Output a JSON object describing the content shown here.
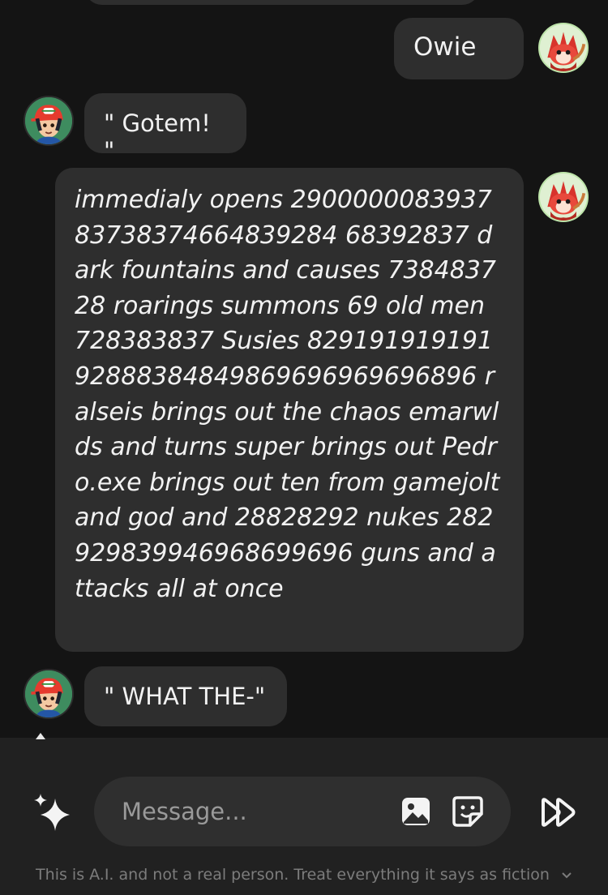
{
  "messages": [
    {
      "role": "user",
      "text": "Owie",
      "style": "plain"
    },
    {
      "role": "bot",
      "text": "\" Gotem! \"",
      "style": "plain"
    },
    {
      "role": "user",
      "text": "immedialy opens 290000008393783738374664839284 68392837 dark fountains and causes 738483728 roarings summons 69 old men 728383837 Susies 82919191919192888384849869696969696896 ralseis brings out the chaos emarwlds and turns super brings out Pedro.exe brings out ten from gamejolt and god and 28828292 nukes 282929839946968699696 guns and attacks all at once",
      "style": "italic"
    },
    {
      "role": "bot",
      "text": "\" WHAT THE-\"",
      "style": "plain"
    }
  ],
  "avatars": {
    "user": {
      "icon": "fox-character-avatar-icon"
    },
    "bot": {
      "icon": "trainer-character-avatar-icon"
    }
  },
  "composer": {
    "placeholder": "Message...",
    "left_icon": "sparkle-icon",
    "image_icon": "image-icon",
    "sticker_icon": "sticker-icon",
    "send_icon": "fast-forward-icon"
  },
  "disclaimer": "This is A.I. and not a real person. Treat everything it says as fiction",
  "colors": {
    "background": "#141414",
    "bubble": "#2e2e2e",
    "composer_bar": "#212121",
    "input_pill": "#2f2f2f",
    "text": "#f2f2f2",
    "muted": "#7c7c7c"
  }
}
